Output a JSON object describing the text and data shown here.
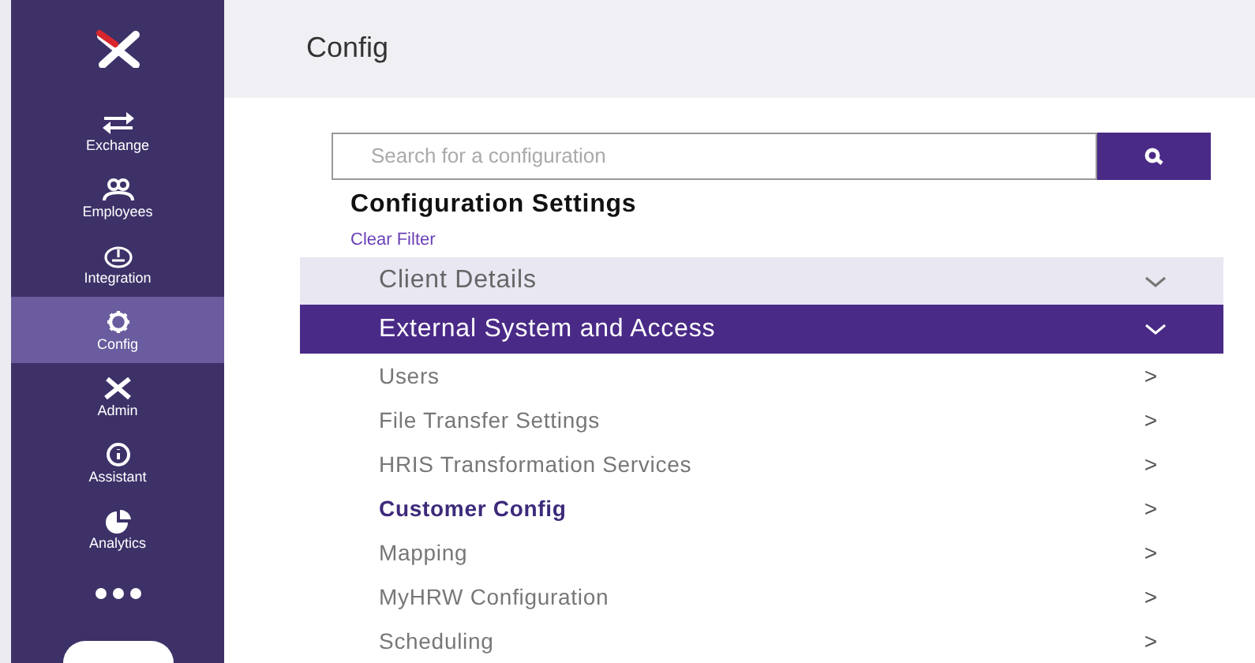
{
  "sidebar": {
    "items": [
      {
        "kind": "exchange",
        "label": "Exchange",
        "selected": false
      },
      {
        "kind": "employees",
        "label": "Employees",
        "selected": false
      },
      {
        "kind": "integration",
        "label": "Integration",
        "selected": false
      },
      {
        "kind": "config",
        "label": "Config",
        "selected": true
      },
      {
        "kind": "admin",
        "label": "Admin",
        "selected": false
      },
      {
        "kind": "assistant",
        "label": "Assistant",
        "selected": false
      },
      {
        "kind": "analytics",
        "label": "Analytics",
        "selected": false
      }
    ]
  },
  "header": {
    "title": "Config"
  },
  "search": {
    "placeholder": "Search for a configuration"
  },
  "settings": {
    "title": "Configuration Settings",
    "clear_filter": "Clear Filter",
    "sections": [
      {
        "label": "Client Details",
        "expanded": false
      },
      {
        "label": "External System and Access",
        "expanded": true,
        "items": [
          {
            "label": "Users",
            "arrow": ">",
            "selected": false
          },
          {
            "label": "File Transfer Settings",
            "arrow": ">",
            "selected": false
          },
          {
            "label": "HRIS Transformation Services",
            "arrow": ">",
            "selected": false
          },
          {
            "label": "Customer Config",
            "arrow": ">",
            "selected": true
          },
          {
            "label": "Mapping",
            "arrow": ">",
            "selected": false
          },
          {
            "label": "MyHRW Configuration",
            "arrow": ">",
            "selected": false
          },
          {
            "label": "Scheduling",
            "arrow": ">",
            "selected": false
          }
        ]
      }
    ]
  }
}
